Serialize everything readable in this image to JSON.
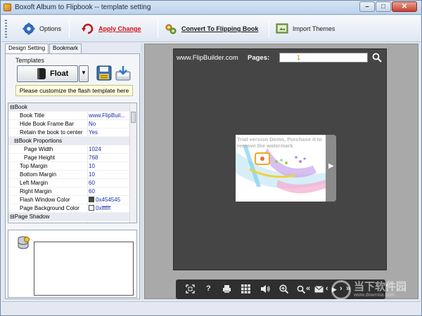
{
  "window": {
    "title": "Boxoft Album to Flipbook -- template setting",
    "controls": [
      "minimize",
      "maximize",
      "close"
    ]
  },
  "toolbar": {
    "items": [
      {
        "label": "Options",
        "icon": "gear-icon"
      },
      {
        "label": "Apply Change",
        "icon": "refresh-icon"
      },
      {
        "label": "Convert To Flipping Book",
        "icon": "convert-icon"
      },
      {
        "label": "Import Themes",
        "icon": "import-themes-icon"
      }
    ]
  },
  "tabs": [
    "Design Setting",
    "Bookmark"
  ],
  "templates": {
    "label": "Templates",
    "selected": "Float",
    "hint": "Please customize the flash template here"
  },
  "properties": [
    {
      "key": "⊟Book",
      "value": "",
      "level": 0,
      "category": true
    },
    {
      "key": "Book Title",
      "value": "www.FlipBuil...",
      "level": 1
    },
    {
      "key": "Hide Book Frame Bar",
      "value": "No",
      "level": 1
    },
    {
      "key": "Retain the book to center",
      "value": "Yes",
      "level": 1
    },
    {
      "key": "⊟Book Proportions",
      "value": "",
      "level": 1,
      "category": true
    },
    {
      "key": "Page Width",
      "value": "1024",
      "level": 2
    },
    {
      "key": "Page Height",
      "value": "768",
      "level": 2
    },
    {
      "key": "Top Margin",
      "value": "10",
      "level": 1
    },
    {
      "key": "Bottom Margin",
      "value": "10",
      "level": 1
    },
    {
      "key": "Left Margin",
      "value": "60",
      "level": 1
    },
    {
      "key": "Right Margin",
      "value": "60",
      "level": 1
    },
    {
      "key": "Flash Window Color",
      "value": "0x454545",
      "level": 1,
      "swatch": "#454545"
    },
    {
      "key": "Page Background Color",
      "value": "0xffffff",
      "level": 1,
      "swatch": "#ffffff"
    },
    {
      "key": "⊟Page Shadow",
      "value": "",
      "level": 0,
      "category": true
    },
    {
      "key": "",
      "value": "",
      "level": 1
    }
  ],
  "preview": {
    "site": "www.FlipBuilder.com",
    "pages_label": "Pages:",
    "page_value": "1",
    "watermark": "Trial version Demo, Purchase it to remove the watermark",
    "controls": [
      "fullscreen-icon",
      "help-icon",
      "print-icon",
      "thumbnails-icon",
      "sound-icon",
      "zoom-in-icon",
      "search-icon",
      "first-page-icon",
      "email-icon",
      "prev-page-icon",
      "next-page-icon",
      "last-page-icon"
    ],
    "window_color": "#454545"
  },
  "watermark_logo": {
    "line1": "当下软件园",
    "line2": "www.downxia.com"
  }
}
